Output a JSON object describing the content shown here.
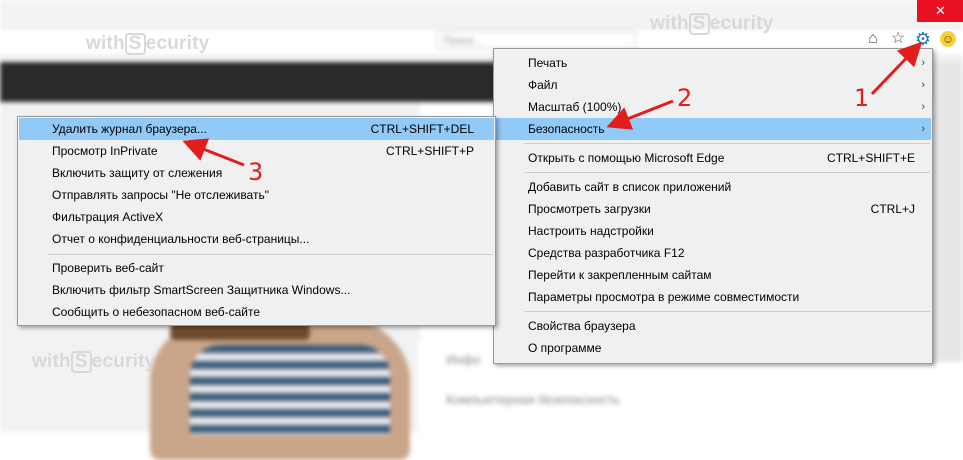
{
  "background": {
    "search_placeholder": "Поиск...",
    "sidebar_items": [
      "Инфо",
      "Компьютерная безопасность"
    ]
  },
  "watermark": {
    "prefix": "with",
    "suffix": "ecurity",
    "badge": "S"
  },
  "toolbar": {
    "home_icon": "home-icon",
    "favorites_icon": "star-icon",
    "tools_icon": "gear-icon",
    "feedback_icon": "smiley-icon",
    "close_symbol": "✕"
  },
  "tools_menu": {
    "items": [
      {
        "label": "Печать",
        "submenu": true
      },
      {
        "label": "Файл",
        "submenu": true
      },
      {
        "label": "Масштаб (100%)",
        "submenu": true
      },
      {
        "label": "Безопасность",
        "submenu": true,
        "highlighted": true
      },
      {
        "label": "Открыть с помощью Microsoft Edge",
        "shortcut": "CTRL+SHIFT+E"
      },
      {
        "label": "Добавить сайт в список приложений"
      },
      {
        "label": "Просмотреть загрузки",
        "shortcut": "CTRL+J"
      },
      {
        "label": "Настроить надстройки"
      },
      {
        "label": "Средства разработчика F12"
      },
      {
        "label": "Перейти к закрепленным сайтам"
      },
      {
        "label": "Параметры просмотра в режиме совместимости"
      },
      {
        "label": "Свойства браузера"
      },
      {
        "label": "О программе"
      }
    ]
  },
  "safety_submenu": {
    "items": [
      {
        "label": "Удалить журнал браузера...",
        "shortcut": "CTRL+SHIFT+DEL",
        "highlighted": true
      },
      {
        "label": "Просмотр InPrivate",
        "shortcut": "CTRL+SHIFT+P"
      },
      {
        "label": "Включить защиту от слежения"
      },
      {
        "label": "Отправлять запросы \"Не отслеживать\""
      },
      {
        "label": "Фильтрация ActiveX"
      },
      {
        "label": "Отчет о конфиденциальности веб-страницы..."
      },
      {
        "label": "Проверить веб-сайт"
      },
      {
        "label": "Включить фильтр SmartScreen Защитника Windows..."
      },
      {
        "label": "Сообщить о небезопасном веб-сайте"
      }
    ]
  },
  "annotations": {
    "step1": "1",
    "step2": "2",
    "step3": "3",
    "color": "#e31c1c"
  }
}
